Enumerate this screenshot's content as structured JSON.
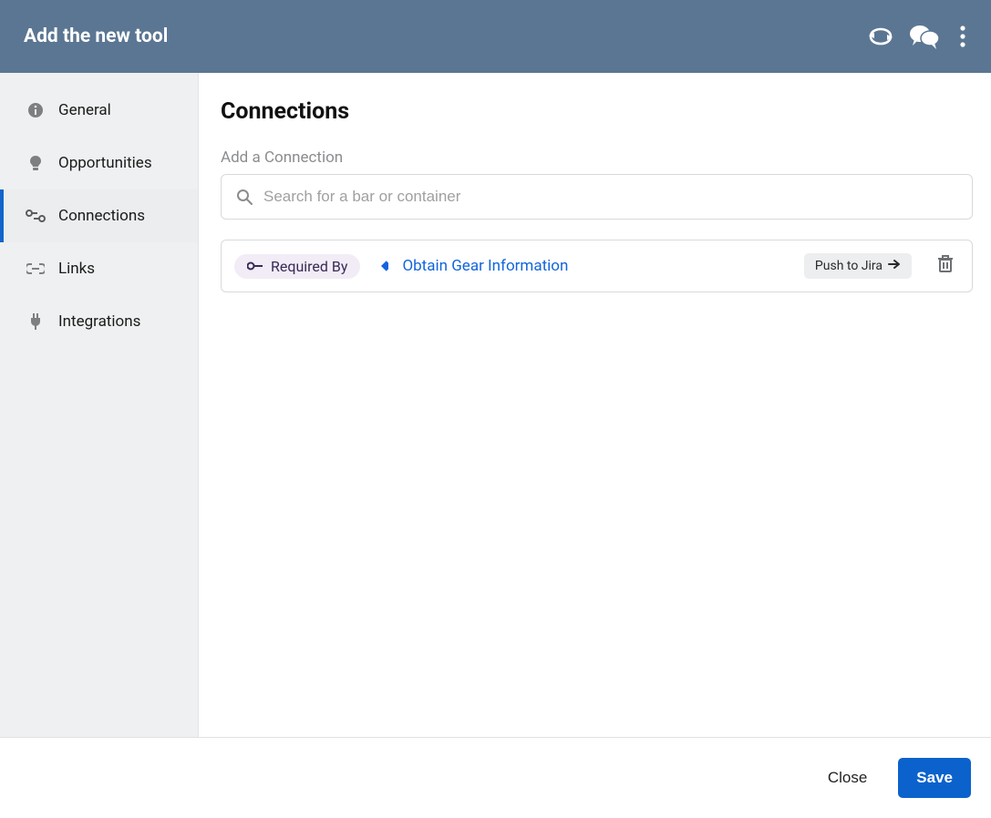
{
  "header": {
    "title": "Add the new tool"
  },
  "sidebar": {
    "items": [
      {
        "label": "General"
      },
      {
        "label": "Opportunities"
      },
      {
        "label": "Connections"
      },
      {
        "label": "Links"
      },
      {
        "label": "Integrations"
      }
    ]
  },
  "main": {
    "heading": "Connections",
    "section_label": "Add a Connection",
    "search_placeholder": "Search for a bar or container",
    "connections": [
      {
        "badge_label": "Required By",
        "link_text": "Obtain Gear Information",
        "push_button_label": "Push to Jira"
      }
    ]
  },
  "footer": {
    "close_label": "Close",
    "save_label": "Save"
  }
}
